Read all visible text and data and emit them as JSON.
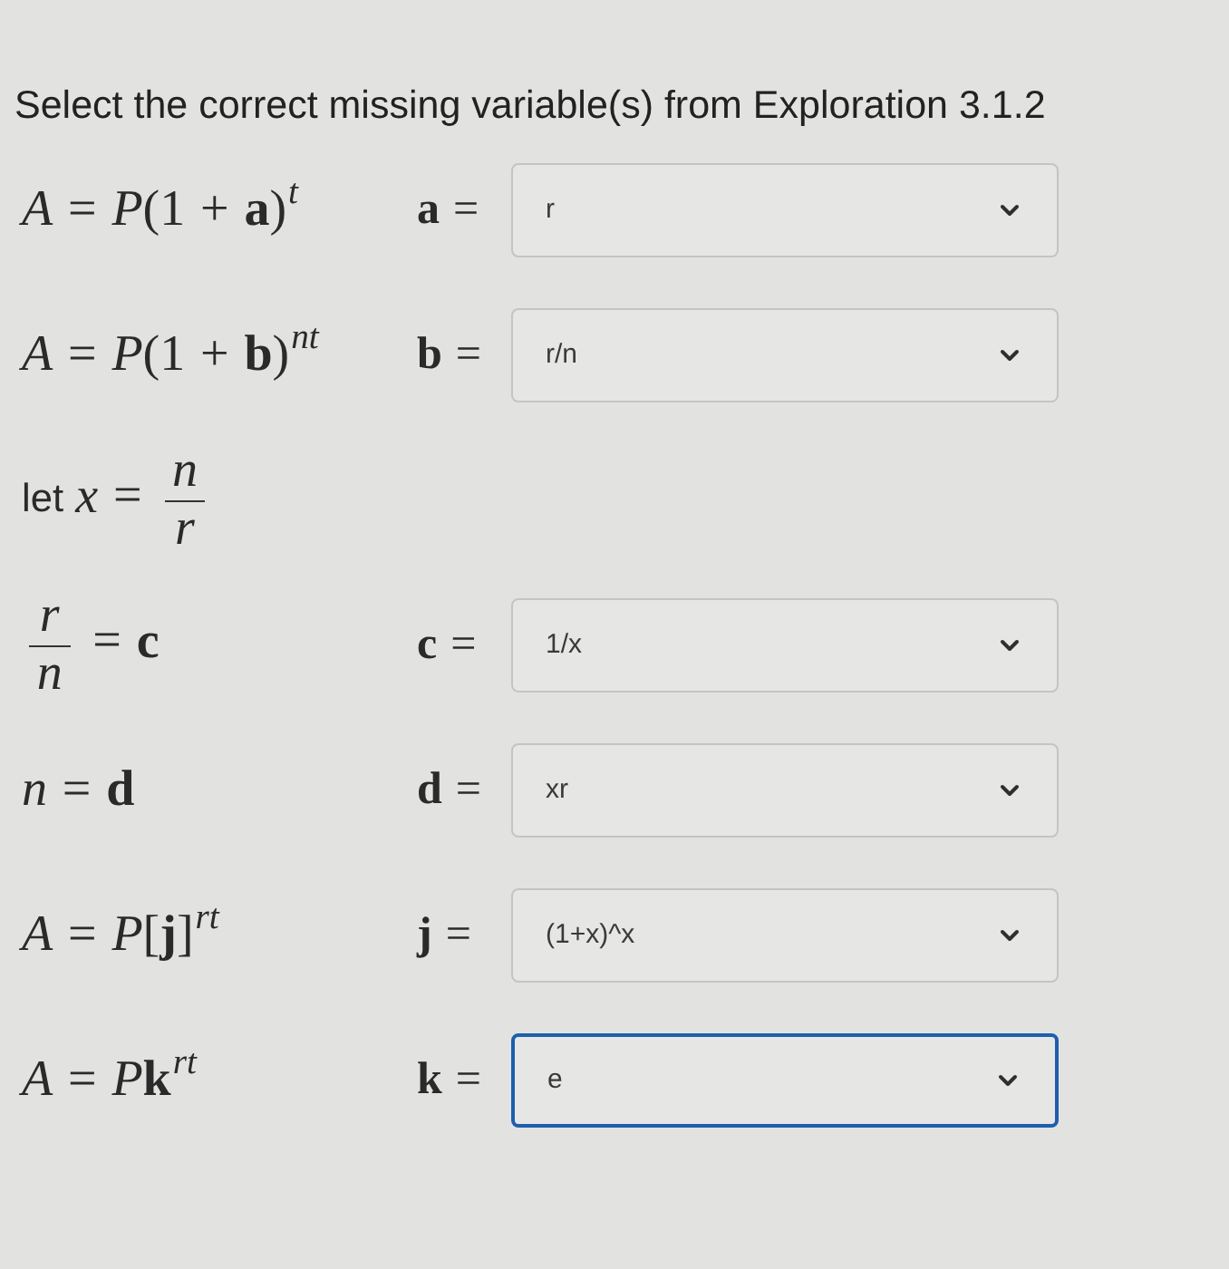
{
  "title": "Select the correct missing variable(s) from Exploration 3.1.2",
  "rows": [
    {
      "equation": [
        {
          "kind": "italic",
          "text": "A"
        },
        {
          "kind": "op",
          "text": "="
        },
        {
          "kind": "italic",
          "text": "P"
        },
        {
          "kind": "roman",
          "text": "(1"
        },
        {
          "kind": "op",
          "text": "+"
        },
        {
          "kind": "bold",
          "text": "a"
        },
        {
          "kind": "roman",
          "text": ")"
        },
        {
          "kind": "sup",
          "text": "t"
        }
      ],
      "label": [
        {
          "kind": "bold",
          "text": "a"
        },
        {
          "kind": "op",
          "text": "="
        }
      ],
      "select": {
        "value": "r",
        "focused": false
      }
    },
    {
      "equation": [
        {
          "kind": "italic",
          "text": "A"
        },
        {
          "kind": "op",
          "text": "="
        },
        {
          "kind": "italic",
          "text": "P"
        },
        {
          "kind": "roman",
          "text": "(1"
        },
        {
          "kind": "op",
          "text": "+"
        },
        {
          "kind": "bold",
          "text": "b"
        },
        {
          "kind": "roman",
          "text": ")"
        },
        {
          "kind": "sup",
          "text": "nt"
        }
      ],
      "label": [
        {
          "kind": "bold",
          "text": "b"
        },
        {
          "kind": "op",
          "text": "="
        }
      ],
      "select": {
        "value": "r/n",
        "focused": false
      }
    },
    {
      "equation": [
        {
          "kind": "word",
          "text": "let"
        },
        {
          "kind": "italic",
          "text": "x"
        },
        {
          "kind": "op",
          "text": "="
        },
        {
          "kind": "fraction",
          "numerator": "n",
          "denominator": "r"
        }
      ]
    },
    {
      "equation": [
        {
          "kind": "fraction",
          "numerator": "r",
          "denominator": "n"
        },
        {
          "kind": "op",
          "text": "="
        },
        {
          "kind": "bold",
          "text": "c"
        }
      ],
      "label": [
        {
          "kind": "bold",
          "text": "c"
        },
        {
          "kind": "op",
          "text": "="
        }
      ],
      "select": {
        "value": "1/x",
        "focused": false
      }
    },
    {
      "equation": [
        {
          "kind": "italic",
          "text": "n"
        },
        {
          "kind": "op",
          "text": "="
        },
        {
          "kind": "bold",
          "text": "d"
        }
      ],
      "label": [
        {
          "kind": "bold",
          "text": "d"
        },
        {
          "kind": "op",
          "text": "="
        }
      ],
      "select": {
        "value": "xr",
        "focused": false
      }
    },
    {
      "equation": [
        {
          "kind": "italic",
          "text": "A"
        },
        {
          "kind": "op",
          "text": "="
        },
        {
          "kind": "italic",
          "text": "P"
        },
        {
          "kind": "roman",
          "text": "["
        },
        {
          "kind": "bold",
          "text": "j"
        },
        {
          "kind": "roman",
          "text": "]"
        },
        {
          "kind": "sup",
          "text": "rt"
        }
      ],
      "label": [
        {
          "kind": "bold",
          "text": "j"
        },
        {
          "kind": "op",
          "text": "="
        }
      ],
      "select": {
        "value": "(1+x)^x",
        "focused": false
      }
    },
    {
      "equation": [
        {
          "kind": "italic",
          "text": "A"
        },
        {
          "kind": "op",
          "text": "="
        },
        {
          "kind": "italic",
          "text": "P"
        },
        {
          "kind": "bold",
          "text": "k"
        },
        {
          "kind": "sup",
          "text": "rt"
        }
      ],
      "label": [
        {
          "kind": "bold",
          "text": "k"
        },
        {
          "kind": "op",
          "text": "="
        }
      ],
      "select": {
        "value": "e",
        "focused": true
      }
    }
  ]
}
